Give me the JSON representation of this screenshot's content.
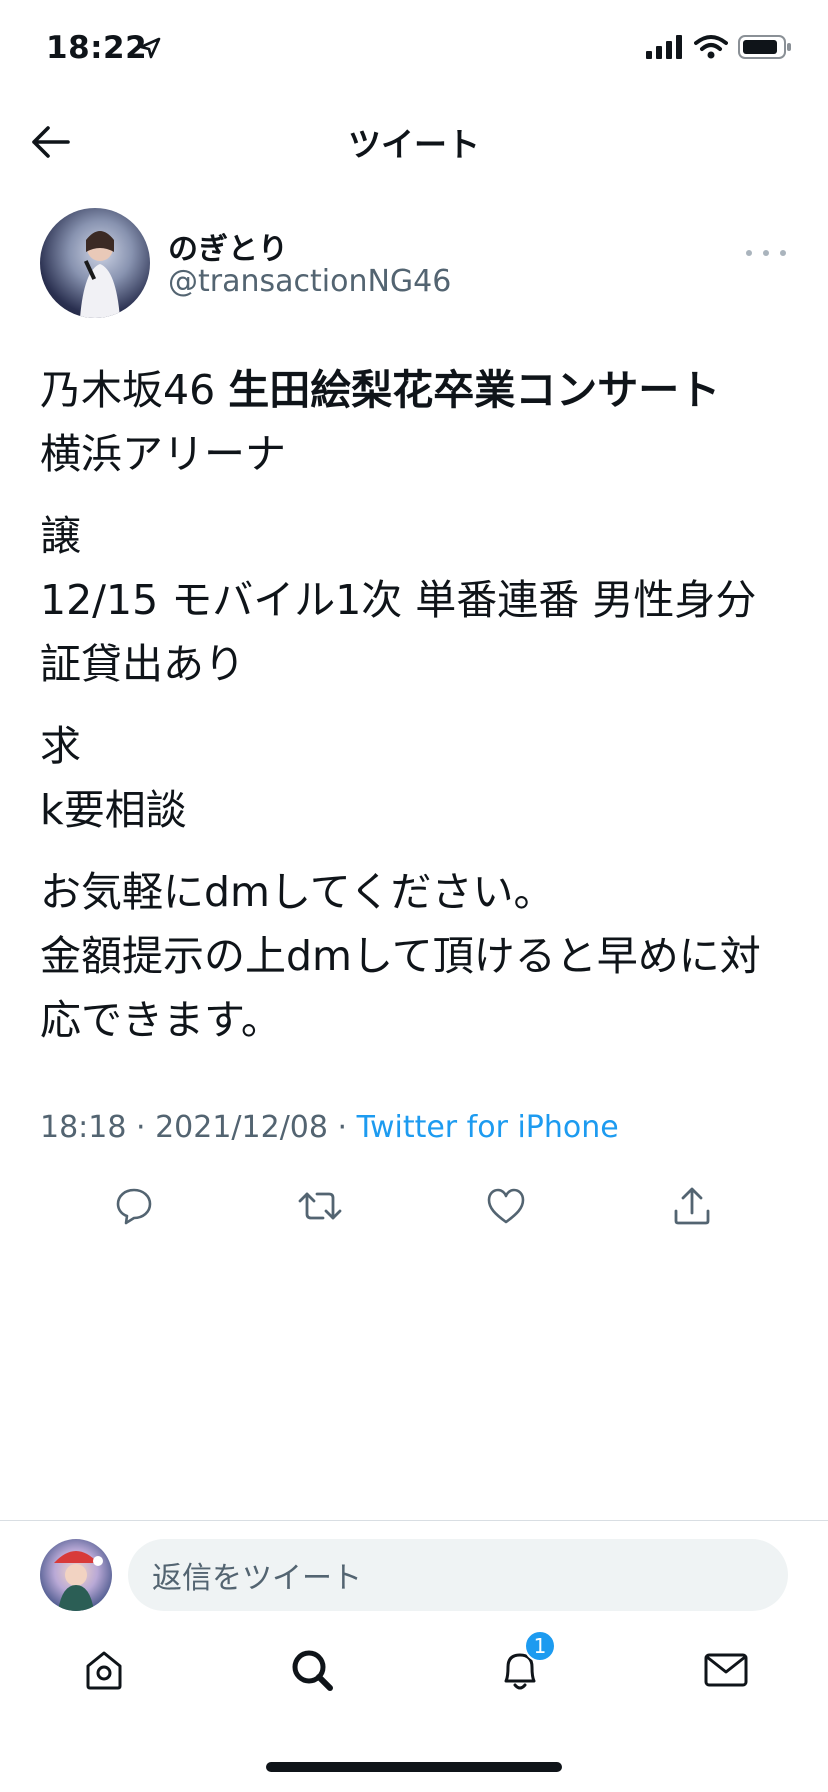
{
  "status_bar": {
    "time": "18:22"
  },
  "header": {
    "title": "ツイート"
  },
  "tweet": {
    "author_name": "のぎとり",
    "author_handle": "@transactionNG46",
    "line1_prefix": "乃木坂46 ",
    "line1_bold": "生田絵梨花卒業コンサート",
    "line2": "横浜アリーナ",
    "para2_line1": "譲",
    "para2_line2": "12/15 モバイル1次 単番連番 男性身分証貸出あり",
    "para3_line1": "求",
    "para3_line2": "k要相談",
    "para4_line1": "お気軽にdmしてください。",
    "para4_line2": "金額提示の上dmして頂けると早めに対応できます。",
    "meta_time": "18:18 · 2021/12/08 · ",
    "meta_source": "Twitter for iPhone"
  },
  "reply": {
    "placeholder": "返信をツイート"
  },
  "tabbar": {
    "notifications_badge": "1"
  },
  "colors": {
    "accent": "#1d9bf0",
    "secondary_text": "#536471",
    "primary_text": "#0f1419"
  }
}
